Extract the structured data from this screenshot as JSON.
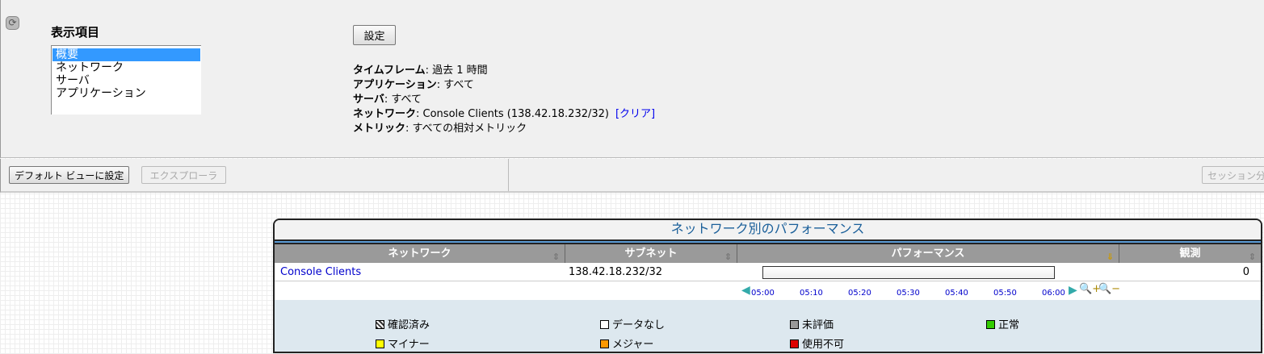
{
  "top": {
    "section_label": "表示項目",
    "list_items": [
      "概要",
      "ネットワーク",
      "サーバ",
      "アプリケーション"
    ],
    "selected": "概要",
    "set_button": "設定",
    "info": [
      {
        "k": "タイムフレーム",
        "v": "過去 1 時間"
      },
      {
        "k": "アプリケーション",
        "v": "すべて"
      },
      {
        "k": "サーバ",
        "v": "すべて"
      },
      {
        "k": "ネットワーク",
        "v": "Console Clients (138.42.18.232/32)"
      },
      {
        "k": "メトリック",
        "v": "すべての相対メトリック"
      }
    ],
    "clear_link": "[クリア]"
  },
  "toolbar": {
    "default_view": "デフォルト ビューに設定",
    "explorer": "エクスプローラ",
    "session": "セッション分"
  },
  "panel": {
    "title": "ネットワーク別のパフォーマンス",
    "columns": [
      "ネットワーク",
      "サブネット",
      "パフォーマンス",
      "観測"
    ],
    "rows": [
      {
        "network": "Console Clients",
        "subnet": "138.42.18.232/32",
        "observed": "0"
      }
    ],
    "timeline": [
      "05:00",
      "05:10",
      "05:20",
      "05:30",
      "05:40",
      "05:50",
      "06:00"
    ],
    "legend": [
      {
        "label": "確認済み",
        "color": "hatch"
      },
      {
        "label": "データなし",
        "color": "#ffffff"
      },
      {
        "label": "未評価",
        "color": "#999999"
      },
      {
        "label": "正常",
        "color": "#33cc00"
      },
      {
        "label": "マイナー",
        "color": "#ffff00"
      },
      {
        "label": "メジャー",
        "color": "#ff9900"
      },
      {
        "label": "使用不可",
        "color": "#dd0000"
      }
    ]
  }
}
